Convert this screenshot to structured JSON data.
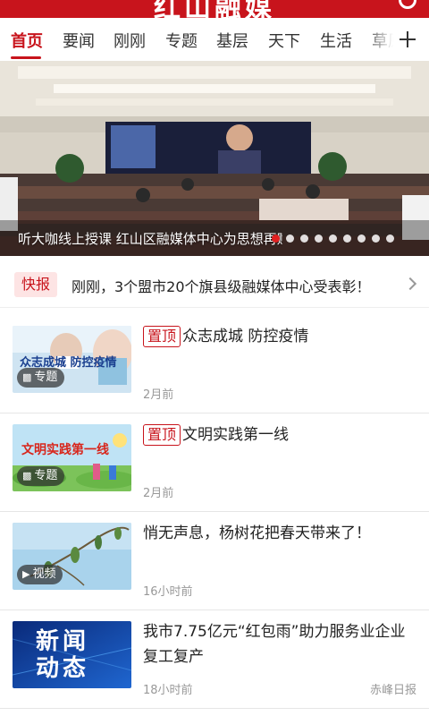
{
  "header": {
    "title": "红山融媒"
  },
  "tabs": [
    "首页",
    "要闻",
    "刚刚",
    "专题",
    "基层",
    "天下",
    "生活",
    "草原"
  ],
  "banner": {
    "caption": "听大咖线上授课 红山区融媒体中心为思想再赋能",
    "dot_count": 9,
    "active_dot": 0
  },
  "flash": {
    "badge": "快报",
    "text": "刚刚，3个盟市20个旗县级融媒体中心受表彰！"
  },
  "news": [
    {
      "pin": "置顶",
      "title": "众志成城 防控疫情",
      "time": "2月前",
      "source": "",
      "tag": "专题",
      "tag_icon": "grid-icon",
      "thumb_text": "众志成城 防控疫情"
    },
    {
      "pin": "置顶",
      "title": "文明实践第一线",
      "time": "2月前",
      "source": "",
      "tag": "专题",
      "tag_icon": "grid-icon",
      "thumb_text": "文明实践第一线"
    },
    {
      "pin": "",
      "title": "悄无声息，杨树花把春天带来了！",
      "time": "16小时前",
      "source": "",
      "tag": "视频",
      "tag_icon": "play-icon",
      "thumb_text": ""
    },
    {
      "pin": "",
      "title": "我市7.75亿元“红包雨”助力服务业企业复工复产",
      "time": "18小时前",
      "source": "赤峰日报",
      "tag": "",
      "tag_icon": "",
      "thumb_text": "新闻动态"
    }
  ],
  "colors": {
    "brand": "#c8141c",
    "flash_bg": "#fde4e4",
    "muted": "#999999"
  }
}
